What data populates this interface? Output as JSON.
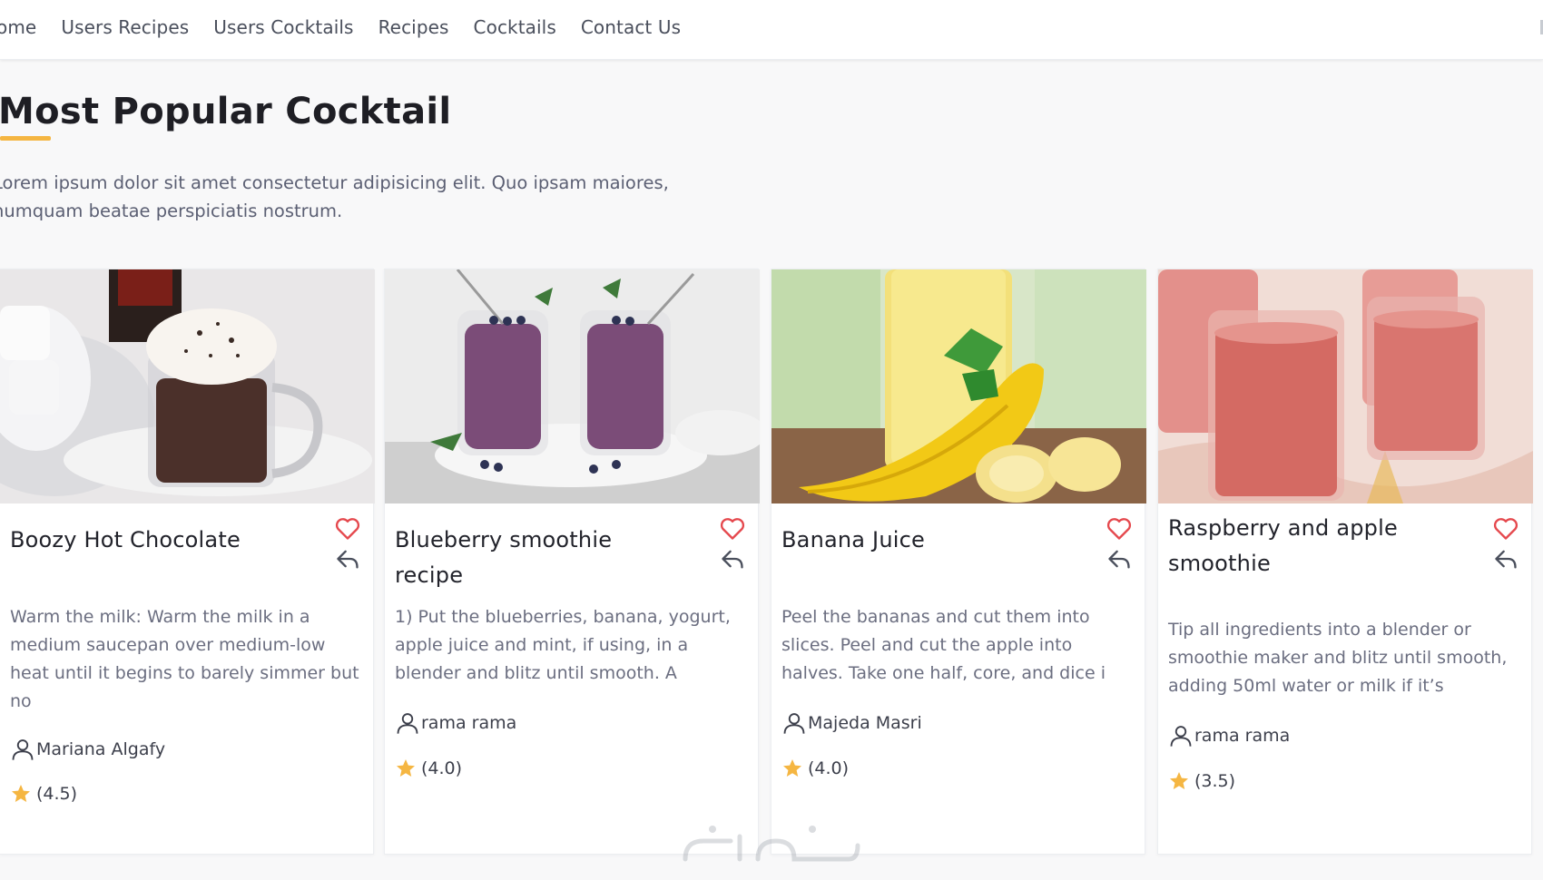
{
  "nav": {
    "items": [
      "ome",
      "Users Recipes",
      "Users Cocktails",
      "Recipes",
      "Cocktails",
      "Contact Us"
    ]
  },
  "section": {
    "title": "Most Popular Cocktail",
    "intro": "Lorem ipsum dolor sit amet consectetur adipisicing elit. Quo ipsam maiores, numquam beatae perspiciatis nostrum."
  },
  "colors": {
    "accent": "#f5b642",
    "heart": "#e5484d",
    "star": "#f5b642"
  },
  "icons": {
    "like": "heart-icon",
    "share": "reply-icon",
    "author": "user-icon",
    "rating": "star-icon"
  },
  "cards": [
    {
      "title": "Boozy Hot Chocolate",
      "description": "Warm the milk: Warm the milk in a medium saucepan over medium-low heat until it begins to barely simmer but no",
      "author": "Mariana Algafy",
      "rating": "(4.5)"
    },
    {
      "title": "Blueberry smoothie recipe",
      "description": "1) Put the blueberries, banana, yogurt, apple juice and mint, if using, in a blender and blitz until smooth. A",
      "author": "rama rama",
      "rating": "(4.0)"
    },
    {
      "title": "Banana Juice",
      "description": "Peel the bananas and cut them into slices. Peel and cut the apple into halves. Take one half, core, and dice i",
      "author": "Majeda Masri",
      "rating": "(4.0)"
    },
    {
      "title": "Raspberry and apple smoothie",
      "description": "Tip all ingredients into a blender or smoothie maker and blitz until smooth, adding 50ml water or milk if it’s",
      "author": "rama rama",
      "rating": "(3.5)"
    }
  ]
}
